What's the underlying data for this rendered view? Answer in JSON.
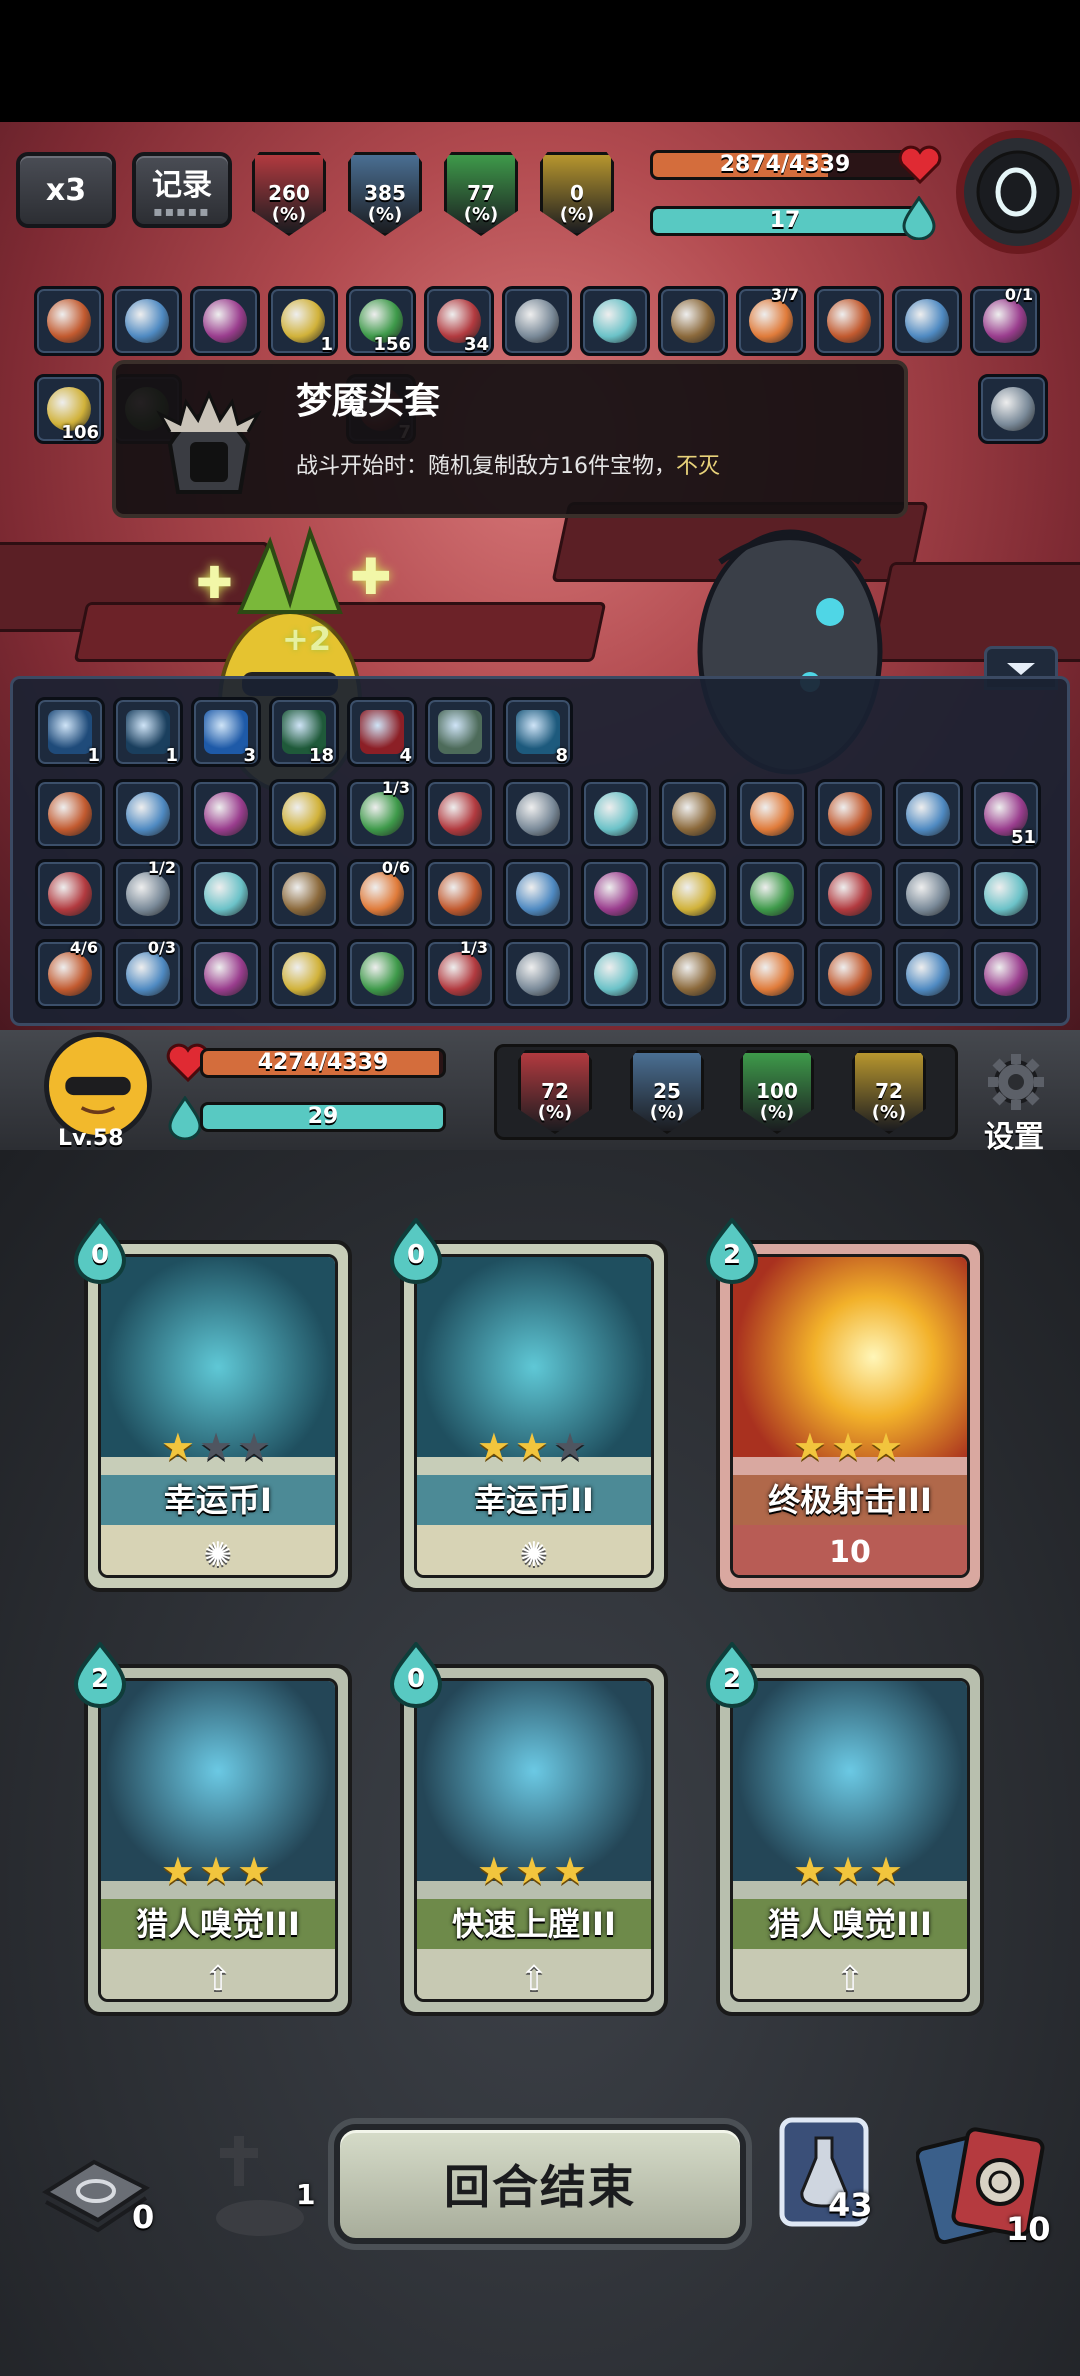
{
  "top": {
    "speed_label": "x3",
    "log_label": "记录"
  },
  "enemy": {
    "stats": [
      {
        "value": "260",
        "pct": "(%)",
        "color": "#b23a3f"
      },
      {
        "value": "385",
        "pct": "(%)",
        "color": "#4a6f93"
      },
      {
        "value": "77",
        "pct": "(%)",
        "color": "#3e9a4a"
      },
      {
        "value": "0",
        "pct": "(%)",
        "color": "#b7962e"
      }
    ],
    "hp_text": "2874/4339",
    "hp_fraction": 0.662,
    "energy_text": "17",
    "energy_fraction": 1.0
  },
  "enemy_relics_row1": [
    {
      "name": "goggles-relic",
      "count": ""
    },
    {
      "name": "hourglass-relic",
      "count": ""
    },
    {
      "name": "red-creature-relic",
      "count": ""
    },
    {
      "name": "storm-orb-relic",
      "count": "1"
    },
    {
      "name": "ghost-relic",
      "count": "156"
    },
    {
      "name": "poison-arrow-relic",
      "count": "34"
    },
    {
      "name": "book-relic",
      "count": ""
    },
    {
      "name": "red-creature-relic-2",
      "count": ""
    },
    {
      "name": "arrows-relic",
      "count": ""
    },
    {
      "name": "pocket-watch-relic",
      "frac": "3/7"
    },
    {
      "name": "nightmare-helmet-relic",
      "count": ""
    },
    {
      "name": "wing-relic",
      "count": ""
    },
    {
      "name": "dark-orb-relic",
      "frac": "0/1"
    }
  ],
  "enemy_relics_row2": [
    {
      "name": "crosshair-relic",
      "count": "106"
    },
    {
      "name": "hidden-1",
      "count": ""
    },
    {
      "name": "hidden-2",
      "count": "7"
    },
    {
      "name": "egg-relic",
      "count": ""
    }
  ],
  "tooltip": {
    "title": "梦魇头套",
    "desc": "战斗开始时：随机复制敌方16件宝物，",
    "desc_highlight": "不灭"
  },
  "heal_popup": "+2",
  "player_buffs": [
    {
      "name": "shield-buff",
      "count": "1",
      "color": "#1f4b7a"
    },
    {
      "name": "whirl-buff",
      "count": "1",
      "color": "#1a3f5e"
    },
    {
      "name": "armor-buff",
      "count": "3",
      "color": "#1e5aa8"
    },
    {
      "name": "slash-buff",
      "count": "18",
      "color": "#1f5a3a"
    },
    {
      "name": "tornado-buff",
      "count": "4",
      "color": "#8c1f26"
    },
    {
      "name": "egg-buff",
      "count": "",
      "color": "#4d6b5a"
    },
    {
      "name": "crosshair-buff",
      "count": "8",
      "color": "#1d5a7d"
    }
  ],
  "player_relics": [
    [
      {
        "name": "goggles-relic",
        "c": ""
      },
      {
        "name": "backpack-relic",
        "c": ""
      },
      {
        "name": "fire-pot-relic",
        "c": ""
      },
      {
        "name": "slime-relic",
        "c": ""
      },
      {
        "name": "glove-relic",
        "f": "1/3"
      },
      {
        "name": "cannon-relic",
        "c": ""
      },
      {
        "name": "witch-hat-relic",
        "c": ""
      },
      {
        "name": "helmet-relic",
        "c": ""
      },
      {
        "name": "star-cone-relic",
        "c": ""
      },
      {
        "name": "mirror-relic",
        "c": ""
      },
      {
        "name": "chainsaw-relic",
        "c": ""
      },
      {
        "name": "egg-relic",
        "c": ""
      },
      {
        "name": "green-hood-relic",
        "c": "51"
      }
    ],
    [
      {
        "name": "teapot-relic",
        "c": ""
      },
      {
        "name": "boots-relic",
        "f": "1/2"
      },
      {
        "name": "knight-helm-relic",
        "c": ""
      },
      {
        "name": "diving-helm-relic",
        "c": ""
      },
      {
        "name": "dynamite-relic",
        "f": "0/6"
      },
      {
        "name": "crystal-relic",
        "c": ""
      },
      {
        "name": "bone-relic",
        "c": ""
      },
      {
        "name": "boxing-glove-relic",
        "c": ""
      },
      {
        "name": "wave-relic",
        "c": ""
      },
      {
        "name": "pants-relic",
        "c": ""
      },
      {
        "name": "rose-relic",
        "c": ""
      },
      {
        "name": "drill-relic",
        "c": ""
      },
      {
        "name": "red-creature-relic",
        "c": ""
      }
    ],
    [
      {
        "name": "cardboard-relic",
        "f": "4/6"
      },
      {
        "name": "sausage-relic",
        "f": "0/3"
      },
      {
        "name": "cauliflower-relic",
        "c": ""
      },
      {
        "name": "axe-relic",
        "c": ""
      },
      {
        "name": "feather-relic",
        "c": ""
      },
      {
        "name": "plant-relic",
        "f": "1/3"
      },
      {
        "name": "rod-relic",
        "c": ""
      },
      {
        "name": "claw-relic",
        "c": ""
      },
      {
        "name": "sack-relic",
        "c": ""
      },
      {
        "name": "banner-relic",
        "c": ""
      },
      {
        "name": "shell-relic",
        "c": ""
      },
      {
        "name": "crossbow-relic",
        "c": ""
      },
      {
        "name": "pistol-relic",
        "c": ""
      }
    ]
  ],
  "player": {
    "level": "Lv.58",
    "hp_text": "4274/4339",
    "hp_fraction": 0.985,
    "energy_text": "29",
    "energy_fraction": 1.0,
    "stats": [
      {
        "value": "72",
        "pct": "(%)",
        "color": "#b23a3f"
      },
      {
        "value": "25",
        "pct": "(%)",
        "color": "#4a6f93"
      },
      {
        "value": "100",
        "pct": "(%)",
        "color": "#3e9a4a"
      },
      {
        "value": "72",
        "pct": "(%)",
        "color": "#b7962e"
      }
    ],
    "settings_label": "设置"
  },
  "cards": [
    {
      "name": "幸运币I",
      "cost": "0",
      "stars": 1,
      "type": "skill",
      "value": ""
    },
    {
      "name": "幸运币II",
      "cost": "0",
      "stars": 2,
      "type": "skill",
      "value": ""
    },
    {
      "name": "终极射击III",
      "cost": "2",
      "stars": 3,
      "type": "attack",
      "value": "10"
    },
    {
      "name": "猎人嗅觉III",
      "cost": "2",
      "stars": 3,
      "type": "buff",
      "value": ""
    },
    {
      "name": "快速上膛III",
      "cost": "0",
      "stars": 3,
      "type": "buff",
      "value": ""
    },
    {
      "name": "猎人嗅觉III",
      "cost": "2",
      "stars": 3,
      "type": "buff",
      "value": ""
    }
  ],
  "bottom": {
    "discard_count": "0",
    "grave_count": "1",
    "end_turn_label": "回合结束",
    "potion_count": "43",
    "draw_count": "10"
  },
  "colors": {
    "hp": "#d46d3c",
    "energy": "#58c9c2",
    "star": "#f2c53d"
  }
}
